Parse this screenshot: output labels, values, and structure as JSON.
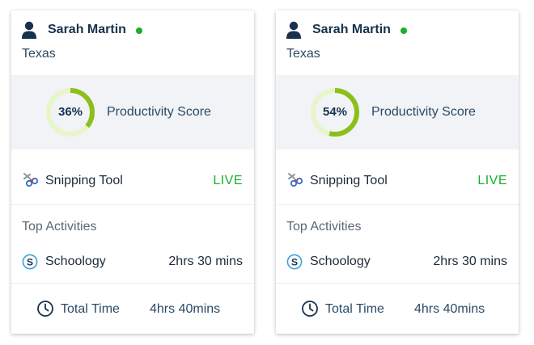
{
  "colors": {
    "online": "#16b02c",
    "ring_track": "#e6f6c8",
    "ring_fill": "#8cbf1a",
    "live": "#16b02c"
  },
  "cards": [
    {
      "user_name": "Sarah Martin",
      "location": "Texas",
      "productivity": {
        "value": 0.36,
        "label": "36%",
        "title": "Productivity Score"
      },
      "current_app": {
        "name": "Snipping Tool",
        "status": "LIVE"
      },
      "top_activities_title": "Top Activities",
      "activity": {
        "name": "Schoology",
        "time": "2hrs 30 mins"
      },
      "total": {
        "label": "Total Time",
        "value": "4hrs 40mins"
      }
    },
    {
      "user_name": "Sarah Martin",
      "location": "Texas",
      "productivity": {
        "value": 0.54,
        "label": "54%",
        "title": "Productivity Score"
      },
      "current_app": {
        "name": "Snipping Tool",
        "status": "LIVE"
      },
      "top_activities_title": "Top Activities",
      "activity": {
        "name": "Schoology",
        "time": "2hrs 30 mins"
      },
      "total": {
        "label": "Total Time",
        "value": "4hrs 40mins"
      }
    }
  ]
}
